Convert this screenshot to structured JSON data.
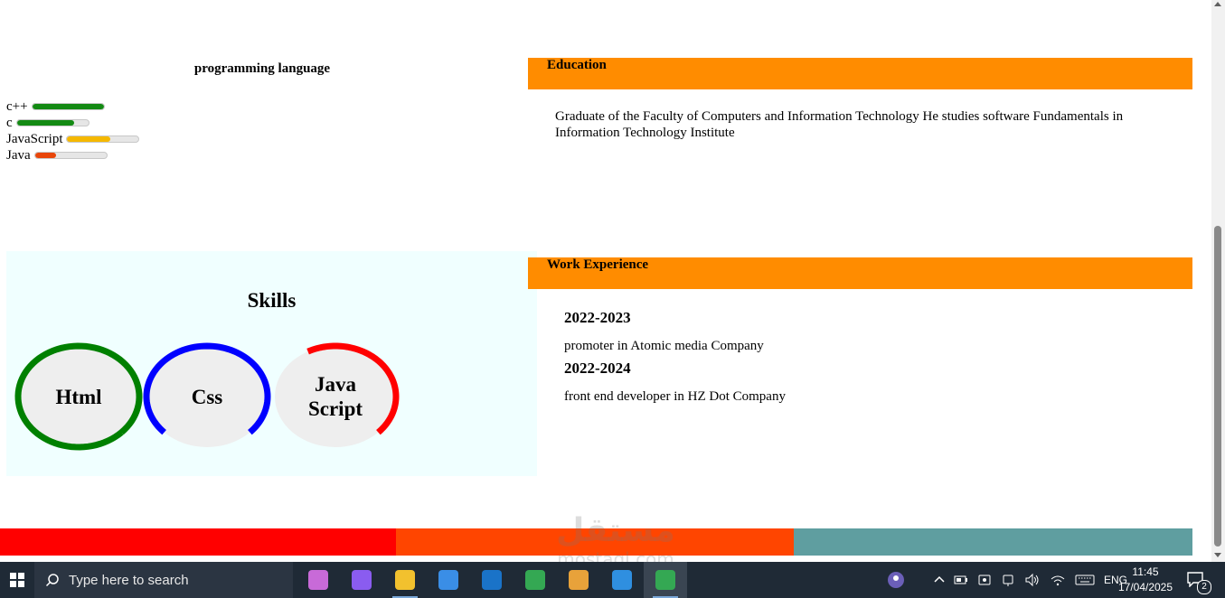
{
  "programming": {
    "title": "programming language",
    "languages": [
      {
        "name": "c++",
        "level": 1.0,
        "color": "#138a13"
      },
      {
        "name": "c",
        "level": 0.8,
        "color": "#138a13"
      },
      {
        "name": "JavaScript",
        "level": 0.6,
        "color": "#f5b800"
      },
      {
        "name": "Java",
        "level": 0.3,
        "color": "#e8460a"
      }
    ]
  },
  "education": {
    "header": "Education",
    "text": "Graduate of the Faculty of Computers and Information Technology He studies software Fundamentals in Information Technology Institute"
  },
  "skills": {
    "title": "Skills",
    "items": [
      {
        "label": "Html",
        "level": 1.0,
        "color": "#008000"
      },
      {
        "label": "Css",
        "level": 0.75,
        "color": "#0000ff"
      },
      {
        "label": "Java Script",
        "level": 0.45,
        "color": "#ff0000"
      }
    ]
  },
  "work": {
    "header": "Work Experience",
    "entries": [
      {
        "year": "2022-2023",
        "desc": "promoter in Atomic media Company"
      },
      {
        "year": "2022-2024",
        "desc": "front end developer in HZ Dot Company"
      }
    ]
  },
  "footer_colors": [
    "#ff0000",
    "#ff4500",
    "#5f9ea0"
  ],
  "watermark": {
    "big": "مستقل",
    "small": "mostaql.com"
  },
  "taskbar": {
    "search_placeholder": "Type here to search",
    "apps": [
      {
        "name": "copilot-icon",
        "color": "#c86ad8",
        "active": false
      },
      {
        "name": "m365-icon",
        "color": "#8a5cf0",
        "active": false
      },
      {
        "name": "file-explorer-icon",
        "color": "#f2c12e",
        "active": false
      },
      {
        "name": "microsoft-store-icon",
        "color": "#3a8ee6",
        "active": false
      },
      {
        "name": "outlook-icon",
        "color": "#1a73c8",
        "active": false
      },
      {
        "name": "chrome-icon",
        "color": "#34a853",
        "active": false
      },
      {
        "name": "app-icon",
        "color": "#e8a23a",
        "active": false
      },
      {
        "name": "vscode-icon",
        "color": "#2f8fe0",
        "active": false
      },
      {
        "name": "chrome-active-icon",
        "color": "#34a853",
        "active": true
      }
    ],
    "language": "ENG",
    "time": "11:45",
    "date": "17/04/2025",
    "notifications": "2"
  }
}
